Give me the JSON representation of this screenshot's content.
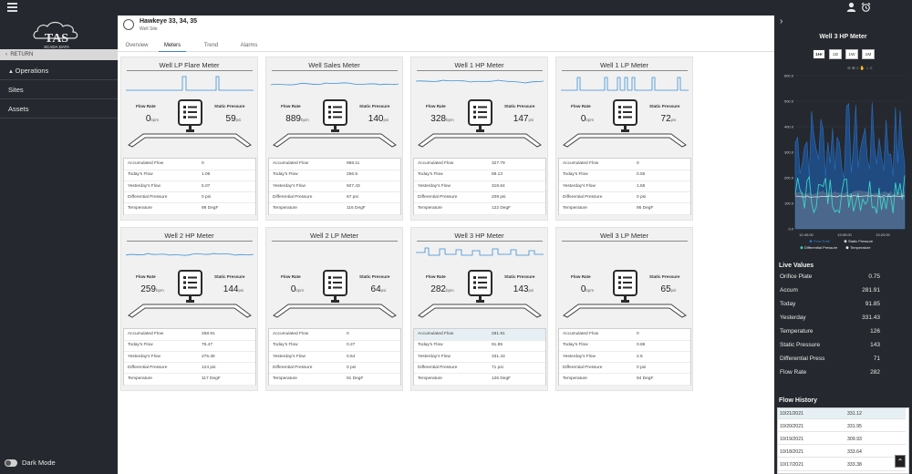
{
  "app": {
    "brand": "TAS",
    "brand_sub": "SCADA DATA"
  },
  "sidebar": {
    "return_label": "RETURN",
    "items": [
      {
        "label": "Operations"
      },
      {
        "label": "Sites"
      },
      {
        "label": "Assets"
      }
    ],
    "dark_mode_label": "Dark Mode"
  },
  "site": {
    "title": "Hawkeye 33, 34, 35",
    "subtitle": "Well Site"
  },
  "tabs": [
    "Overview",
    "Meters",
    "Trend",
    "Alarms"
  ],
  "meters": [
    {
      "title": "Well LP Flare Meter",
      "flow_label": "Flow Rate",
      "flow": "0",
      "flow_unit": "bpm",
      "sp_label": "Static Pressure",
      "sp": "59",
      "sp_unit": "psi",
      "rows": [
        [
          "Accumulated Flow",
          "0"
        ],
        [
          "Today's Flow",
          "1.06"
        ],
        [
          "Yesterday's Flow",
          "5.07"
        ],
        [
          "Differential Pressure",
          "0 psi"
        ],
        [
          "Temperature",
          "98 DegF"
        ]
      ]
    },
    {
      "title": "Well Sales Meter",
      "flow_label": "Flow Rate",
      "flow": "889",
      "flow_unit": "bpm",
      "sp_label": "Static Pressure",
      "sp": "140",
      "sp_unit": "psi",
      "rows": [
        [
          "Accumulated Flow",
          "968.11"
        ],
        [
          "Today's Flow",
          "256.5"
        ],
        [
          "Yesterday's Flow",
          "927.43"
        ],
        [
          "Differential Pressure",
          "67 psi"
        ],
        [
          "Temperature",
          "116 DegF"
        ]
      ]
    },
    {
      "title": "Well 1 HP Meter",
      "flow_label": "Flow Rate",
      "flow": "328",
      "flow_unit": "bpm",
      "sp_label": "Static Pressure",
      "sp": "147",
      "sp_unit": "psi",
      "rows": [
        [
          "Accumulated Flow",
          "327.79"
        ],
        [
          "Today's Flow",
          "88.13"
        ],
        [
          "Yesterday's Flow",
          "318.64"
        ],
        [
          "Differential Pressure",
          "209 psi"
        ],
        [
          "Temperature",
          "122 DegF"
        ]
      ]
    },
    {
      "title": "Well 1 LP Meter",
      "flow_label": "Flow Rate",
      "flow": "0",
      "flow_unit": "bpm",
      "sp_label": "Static Pressure",
      "sp": "72",
      "sp_unit": "psi",
      "rows": [
        [
          "Accumulated Flow",
          "0"
        ],
        [
          "Today's Flow",
          "0.55"
        ],
        [
          "Yesterday's Flow",
          "1.55"
        ],
        [
          "Differential Pressure",
          "0 psi"
        ],
        [
          "Temperature",
          "95 DegF"
        ]
      ]
    },
    {
      "title": "Well 2 HP Meter",
      "flow_label": "Flow Rate",
      "flow": "259",
      "flow_unit": "bpm",
      "sp_label": "Static Pressure",
      "sp": "144",
      "sp_unit": "psi",
      "rows": [
        [
          "Accumulated Flow",
          "258.91"
        ],
        [
          "Today's Flow",
          "76.47"
        ],
        [
          "Yesterday's Flow",
          "275.36"
        ],
        [
          "Differential Pressure",
          "124 psi"
        ],
        [
          "Temperature",
          "117 DegF"
        ]
      ]
    },
    {
      "title": "Well 2 LP Meter",
      "flow_label": "Flow Rate",
      "flow": "0",
      "flow_unit": "bpm",
      "sp_label": "Static Pressure",
      "sp": "64",
      "sp_unit": "psi",
      "rows": [
        [
          "Accumulated Flow",
          "0"
        ],
        [
          "Today's Flow",
          "0.27"
        ],
        [
          "Yesterday's Flow",
          "0.64"
        ],
        [
          "Differential Pressure",
          "0 psi"
        ],
        [
          "Temperature",
          "91 DegF"
        ]
      ]
    },
    {
      "title": "Well 3 HP Meter",
      "flow_label": "Flow Rate",
      "flow": "282",
      "flow_unit": "bpm",
      "sp_label": "Static Pressure",
      "sp": "143",
      "sp_unit": "psi",
      "rows": [
        [
          "Accumulated Flow",
          "281.91"
        ],
        [
          "Today's Flow",
          "91.85"
        ],
        [
          "Yesterday's Flow",
          "331.43"
        ],
        [
          "Differential Pressure",
          "71 psi"
        ],
        [
          "Temperature",
          "126 DegF"
        ]
      ]
    },
    {
      "title": "Well 3 LP Meter",
      "flow_label": "Flow Rate",
      "flow": "0",
      "flow_unit": "bpm",
      "sp_label": "Static Pressure",
      "sp": "65",
      "sp_unit": "psi",
      "rows": [
        [
          "Accumulated Flow",
          "0"
        ],
        [
          "Today's Flow",
          "0.86"
        ],
        [
          "Yesterday's Flow",
          "2.5"
        ],
        [
          "Differential Pressure",
          "0 psi"
        ],
        [
          "Temperature",
          "94 DegF"
        ]
      ]
    }
  ],
  "panel": {
    "chart_title": "Well 3 HP Meter",
    "ranges": [
      "1Hr",
      "1D",
      "1W",
      "1M"
    ],
    "selected_range": "1Hr",
    "yticks": [
      "600.0",
      "500.0",
      "400.0",
      "300.0",
      "200.0",
      "100.0",
      "0.0"
    ],
    "xticks": [
      "12:40:00",
      "13:00:00",
      "13:20:00"
    ],
    "legend": [
      "Flow Rate",
      "Static Pressure",
      "Differential Pressure",
      "Temperature"
    ],
    "live_title": "Live Values",
    "live": [
      [
        "Orifice Plate",
        "0.75"
      ],
      [
        "Accum",
        "281.91"
      ],
      [
        "Today",
        "91.85"
      ],
      [
        "Yesterday",
        "331.43"
      ],
      [
        "Temperature",
        "126"
      ],
      [
        "Static Pressure",
        "143"
      ],
      [
        "Differential Press",
        "71"
      ],
      [
        "Flow Rate",
        "282"
      ]
    ],
    "history_title": "Flow History",
    "history": [
      [
        "10/21/2021",
        "331.12"
      ],
      [
        "10/20/2021",
        "331.95"
      ],
      [
        "10/19/2021",
        "309.93"
      ],
      [
        "10/18/2021",
        "333.64"
      ],
      [
        "10/17/2021",
        "333.38"
      ]
    ]
  },
  "colors": {
    "dark": "#25282e",
    "accent": "#3d7fd6",
    "flow_series": "#1f5ea8",
    "static_series": "#cfd8e0",
    "diff_series": "#3fd3c4",
    "temp_series": "#e9eef2"
  }
}
